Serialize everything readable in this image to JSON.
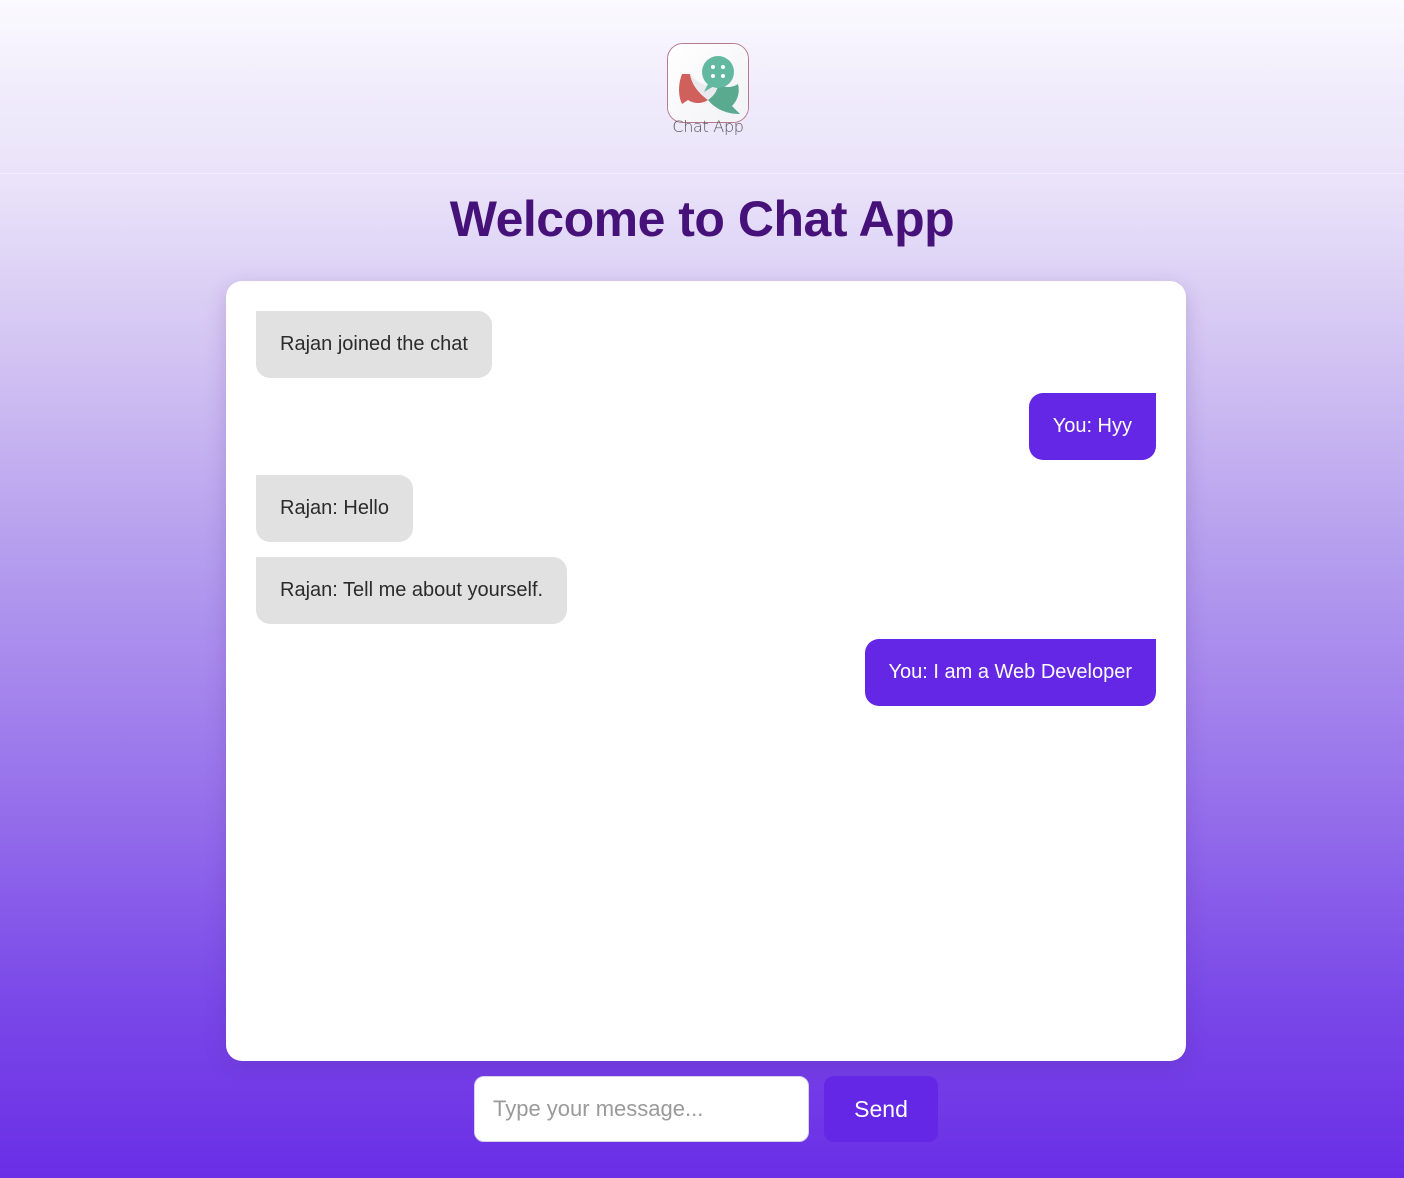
{
  "header": {
    "logo_text": "Chat App"
  },
  "title": "Welcome to Chat App",
  "messages": [
    {
      "sender": "other",
      "text": "Rajan joined the chat"
    },
    {
      "sender": "self",
      "text": "You: Hyy"
    },
    {
      "sender": "other",
      "text": "Rajan: Hello"
    },
    {
      "sender": "other",
      "text": "Rajan: Tell me about yourself."
    },
    {
      "sender": "self",
      "text": "You: I am a Web Developer"
    }
  ],
  "composer": {
    "placeholder": "Type your message...",
    "value": "",
    "send_label": "Send"
  },
  "colors": {
    "accent": "#6427e5",
    "title": "#46127a",
    "bubble_other": "#e1e1e1"
  }
}
